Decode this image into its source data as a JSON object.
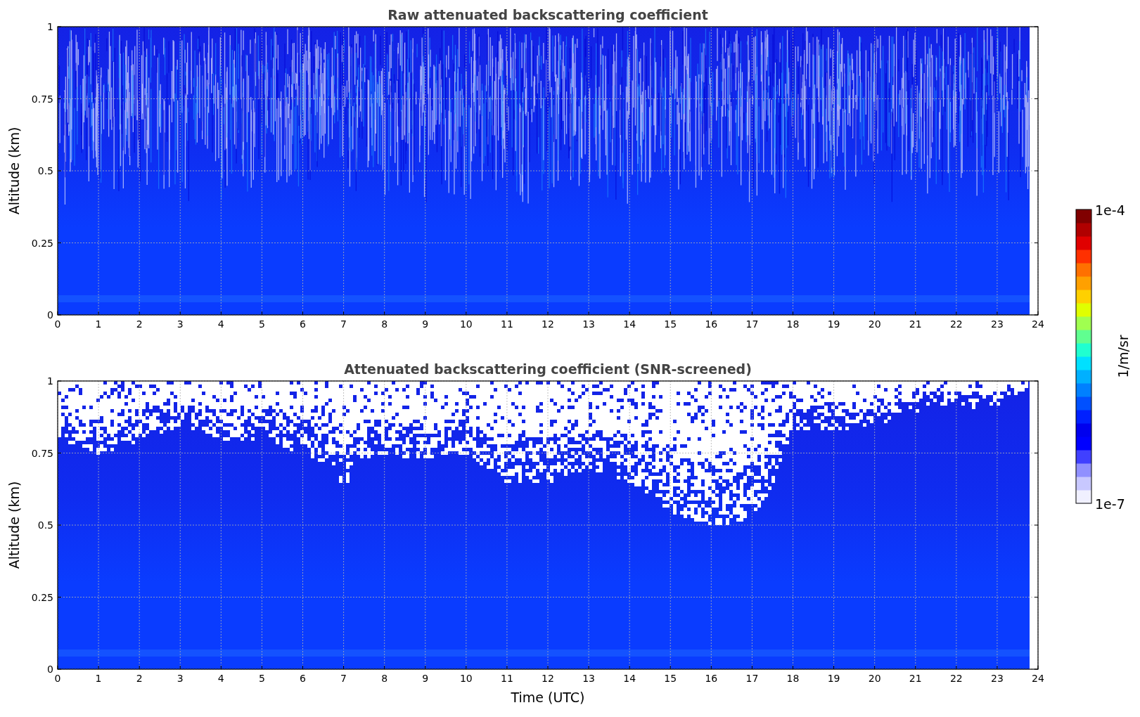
{
  "panels": [
    {
      "kind": "raw",
      "title": "Raw attenuated backscattering coefficient",
      "ylabel": "Altitude (km)",
      "yticks": [
        "1",
        "0.75",
        "0.5",
        "0.25",
        "0"
      ],
      "xticks": [
        "0",
        "1",
        "2",
        "3",
        "4",
        "5",
        "6",
        "7",
        "8",
        "9",
        "10",
        "11",
        "12",
        "13",
        "14",
        "15",
        "16",
        "17",
        "18",
        "19",
        "20",
        "21",
        "22",
        "23",
        "24"
      ]
    },
    {
      "kind": "screened",
      "title": "Attenuated backscattering coefficient (SNR-screened)",
      "ylabel": "Altitude (km)",
      "xlabel": "Time (UTC)",
      "yticks": [
        "1",
        "0.75",
        "0.5",
        "0.25",
        "0"
      ],
      "xticks": [
        "0",
        "1",
        "2",
        "3",
        "4",
        "5",
        "6",
        "7",
        "8",
        "9",
        "10",
        "11",
        "12",
        "13",
        "14",
        "15",
        "16",
        "17",
        "18",
        "19",
        "20",
        "21",
        "22",
        "23",
        "24"
      ]
    }
  ],
  "colorbar": {
    "max_label": "1e-4",
    "min_label": "1e-7",
    "label": "1/m/sr"
  }
}
